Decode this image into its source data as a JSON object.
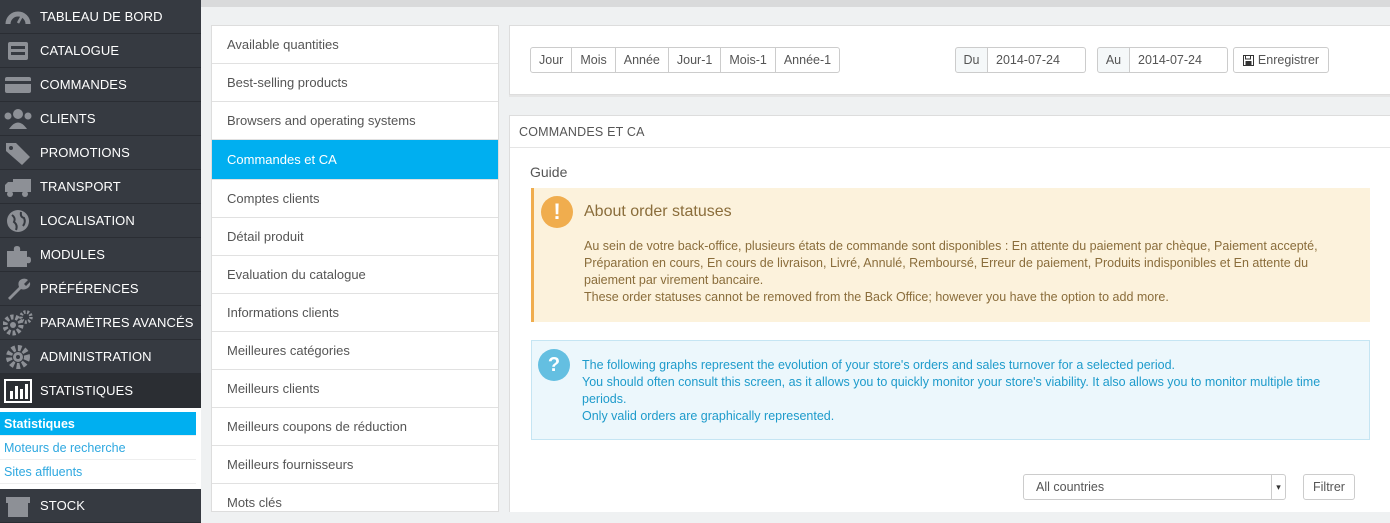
{
  "sidebar": {
    "items": [
      {
        "label": "TABLEAU DE BORD",
        "icon": "dashboard-icon"
      },
      {
        "label": "CATALOGUE",
        "icon": "book-icon"
      },
      {
        "label": "COMMANDES",
        "icon": "credit-card-icon"
      },
      {
        "label": "CLIENTS",
        "icon": "users-icon"
      },
      {
        "label": "PROMOTIONS",
        "icon": "tags-icon"
      },
      {
        "label": "TRANSPORT",
        "icon": "truck-icon"
      },
      {
        "label": "LOCALISATION",
        "icon": "globe-icon"
      },
      {
        "label": "MODULES",
        "icon": "puzzle-icon"
      },
      {
        "label": "PRÉFÉRENCES",
        "icon": "wrench-icon"
      },
      {
        "label": "PARAMÈTRES AVANCÉS",
        "icon": "cogs-icon"
      },
      {
        "label": "ADMINISTRATION",
        "icon": "cog-icon"
      },
      {
        "label": "STATISTIQUES",
        "icon": "bar-chart-icon"
      },
      {
        "label": "STOCK",
        "icon": "box-icon"
      }
    ],
    "submenu": [
      "Statistiques",
      "Moteurs de recherche",
      "Sites affluents"
    ]
  },
  "stats_list": [
    "Available quantities",
    "Best-selling products",
    "Browsers and operating systems",
    "Commandes et CA",
    "Comptes clients",
    "Détail produit",
    "Evaluation du catalogue",
    "Informations clients",
    "Meilleures catégories",
    "Meilleurs clients",
    "Meilleurs coupons de réduction",
    "Meilleurs fournisseurs",
    "Mots clés"
  ],
  "toolbar": {
    "periods": [
      "Jour",
      "Mois",
      "Année",
      "Jour-1",
      "Mois-1",
      "Année-1"
    ],
    "from_label": "Du",
    "from_value": "2014-07-24",
    "to_label": "Au",
    "to_value": "2014-07-24",
    "save_label": "Enregistrer"
  },
  "main": {
    "heading": "COMMANDES ET CA",
    "guide": "Guide",
    "warning_title": "About order statuses",
    "warning_text_1": "Au sein de votre back-office, plusieurs états de commande sont disponibles : En attente du paiement par chèque, Paiement accepté, Préparation en cours, En cours de livraison, Livré, Annulé, Remboursé, Erreur de paiement, Produits indisponibles et En attente du paiement par virement bancaire.",
    "warning_text_2": "These order statuses cannot be removed from the Back Office; however you have the option to add more.",
    "info_text_1": "The following graphs represent the evolution of your store's orders and sales turnover for a selected period.",
    "info_text_2": "You should often consult this screen, as it allows you to quickly monitor your store's viability. It also allows you to monitor multiple time periods.",
    "info_text_3": "Only valid orders are graphically represented.",
    "country_select": "All countries",
    "filter_label": "Filtrer"
  },
  "colors": {
    "sidebar_bg": "#363a41",
    "accent": "#00aff0",
    "warning_bg": "#fcf2dc",
    "info_bg": "#ecf7fc"
  }
}
